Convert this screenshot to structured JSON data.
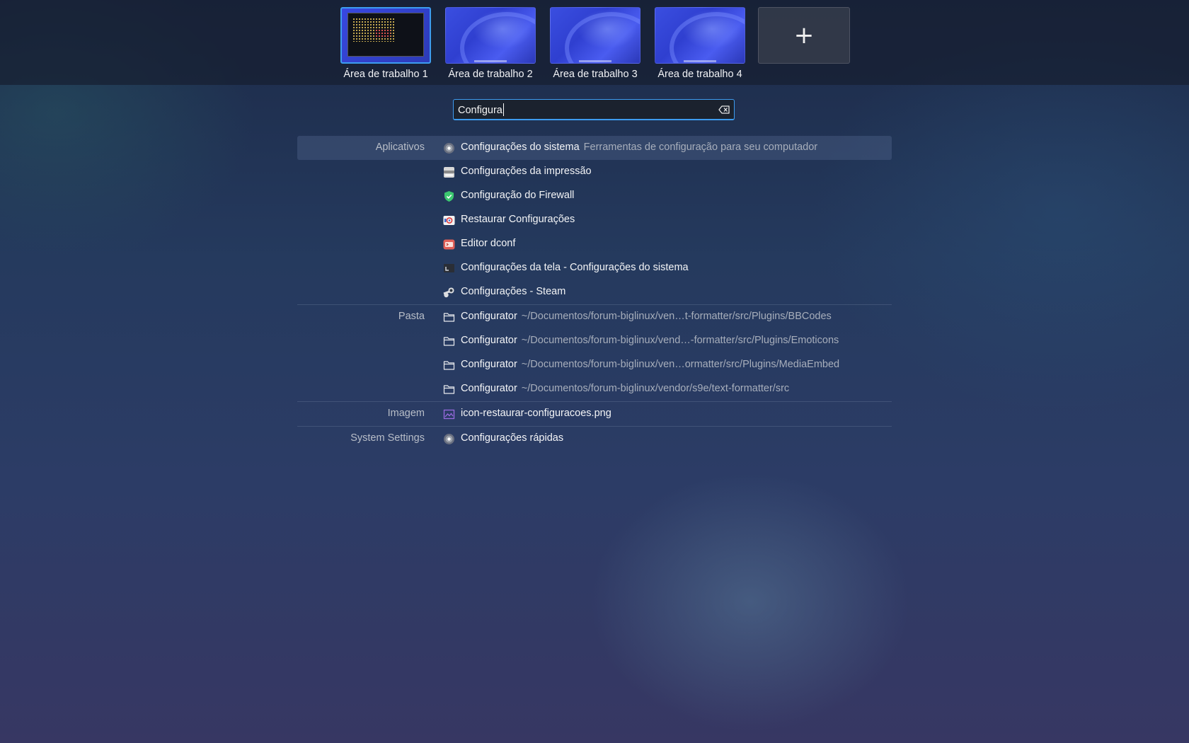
{
  "desktops": [
    {
      "label": "Área de trabalho 1",
      "active": true
    },
    {
      "label": "Área de trabalho 2",
      "active": false
    },
    {
      "label": "Área de trabalho 3",
      "active": false
    },
    {
      "label": "Área de trabalho 4",
      "active": false
    }
  ],
  "add_desktop_label": "+",
  "search": {
    "value": "Configura",
    "clear_icon": "clear-input-icon"
  },
  "groups": [
    {
      "category": "Aplicativos",
      "items": [
        {
          "title": "Configurações do sistema",
          "subtitle": "Ferramentas de configuração para seu computador",
          "icon": "system-settings-icon",
          "selected": true
        },
        {
          "title": "Configurações da impressão",
          "subtitle": "",
          "icon": "printer-icon"
        },
        {
          "title": "Configuração do Firewall",
          "subtitle": "",
          "icon": "firewall-shield-icon"
        },
        {
          "title": "Restaurar Configurações",
          "subtitle": "",
          "icon": "restore-settings-icon"
        },
        {
          "title": "Editor dconf",
          "subtitle": "",
          "icon": "dconf-editor-icon"
        },
        {
          "title": "Configurações da tela - Configurações do sistema",
          "subtitle": "",
          "icon": "display-settings-icon"
        },
        {
          "title": "Configurações - Steam",
          "subtitle": "",
          "icon": "steam-icon"
        }
      ]
    },
    {
      "category": "Pasta",
      "items": [
        {
          "title": "Configurator",
          "subtitle": "~/Documentos/forum-biglinux/ven…t-formatter/src/Plugins/BBCodes",
          "icon": "folder-icon"
        },
        {
          "title": "Configurator",
          "subtitle": "~/Documentos/forum-biglinux/vend…-formatter/src/Plugins/Emoticons",
          "icon": "folder-icon"
        },
        {
          "title": "Configurator",
          "subtitle": "~/Documentos/forum-biglinux/ven…ormatter/src/Plugins/MediaEmbed",
          "icon": "folder-icon"
        },
        {
          "title": "Configurator",
          "subtitle": "~/Documentos/forum-biglinux/vendor/s9e/text-formatter/src",
          "icon": "folder-icon"
        }
      ]
    },
    {
      "category": "Imagem",
      "items": [
        {
          "title": "icon-restaurar-configuracoes.png",
          "subtitle": "",
          "icon": "image-file-icon"
        }
      ]
    },
    {
      "category": "System Settings",
      "items": [
        {
          "title": "Configurações rápidas",
          "subtitle": "",
          "icon": "system-settings-icon"
        }
      ]
    }
  ],
  "colors": {
    "accent": "#3d9cf0",
    "firewall_green": "#3cc870",
    "dconf_red": "#e06058"
  }
}
